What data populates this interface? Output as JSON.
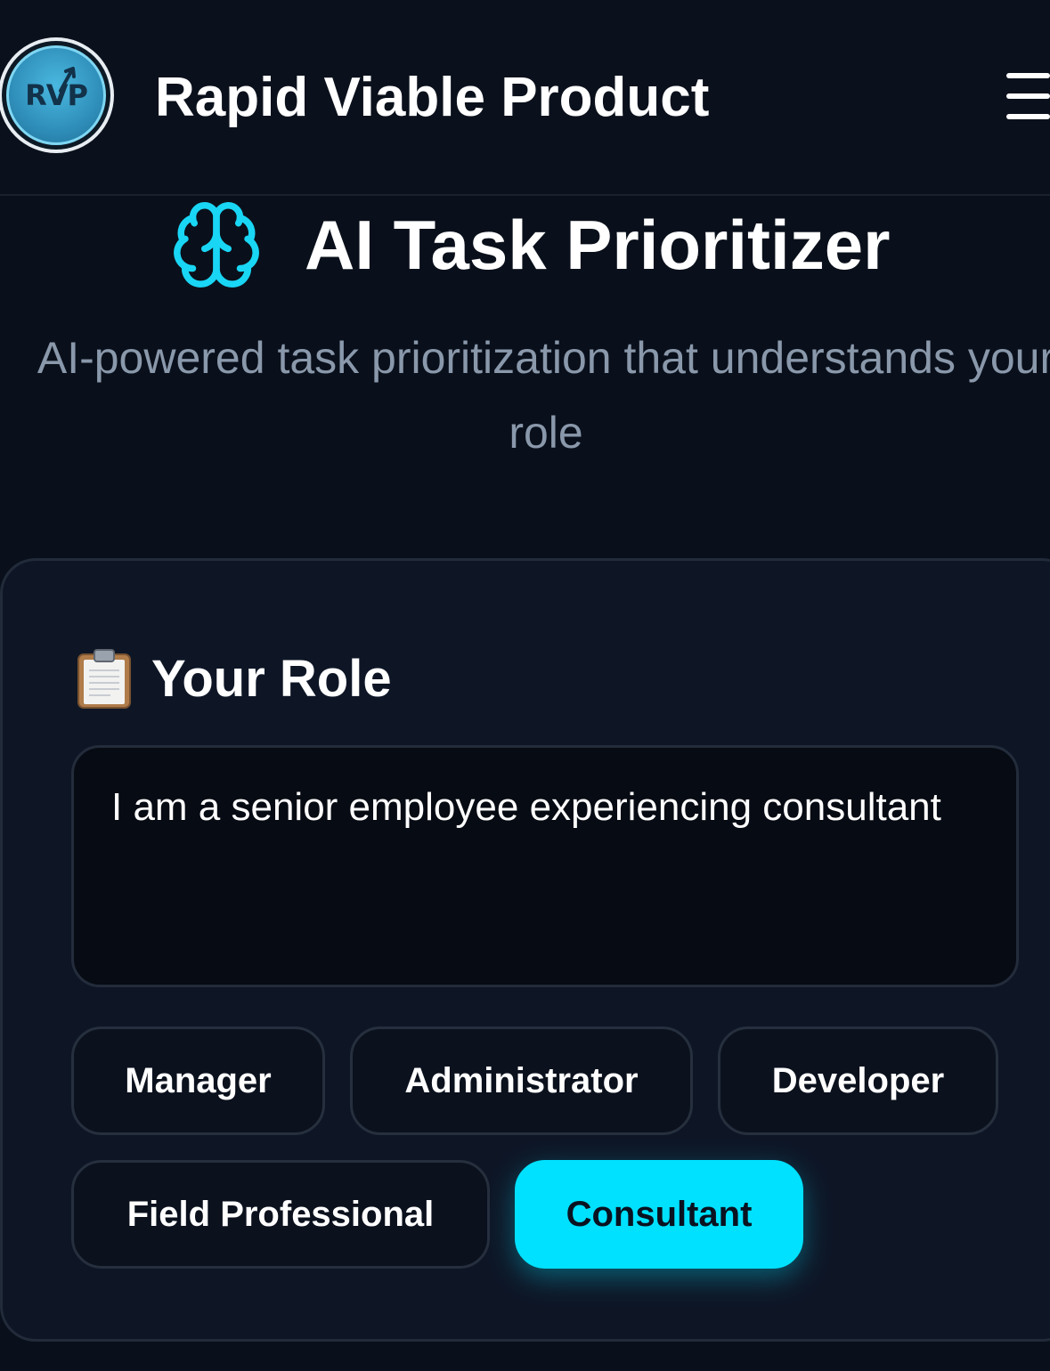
{
  "header": {
    "logo_text": "RVP",
    "brand": "Rapid Viable Product",
    "menu_icon": "hamburger-menu-icon"
  },
  "hero": {
    "icon": "brain-icon",
    "title": "AI Task Prioritizer",
    "subtitle": "AI-powered task prioritization that understands your role"
  },
  "role_section": {
    "icon": "clipboard-icon",
    "title": "Your Role",
    "input_value": "I am a senior employee experiencing consultant",
    "chips": [
      {
        "label": "Manager",
        "active": false
      },
      {
        "label": "Administrator",
        "active": false
      },
      {
        "label": "Developer",
        "active": false
      },
      {
        "label": "Field Professional",
        "active": false
      },
      {
        "label": "Consultant",
        "active": true
      }
    ]
  },
  "colors": {
    "background": "#0a101b",
    "accent": "#00e1ff",
    "subtitle": "#8a98ab",
    "card": "#0e1626"
  }
}
